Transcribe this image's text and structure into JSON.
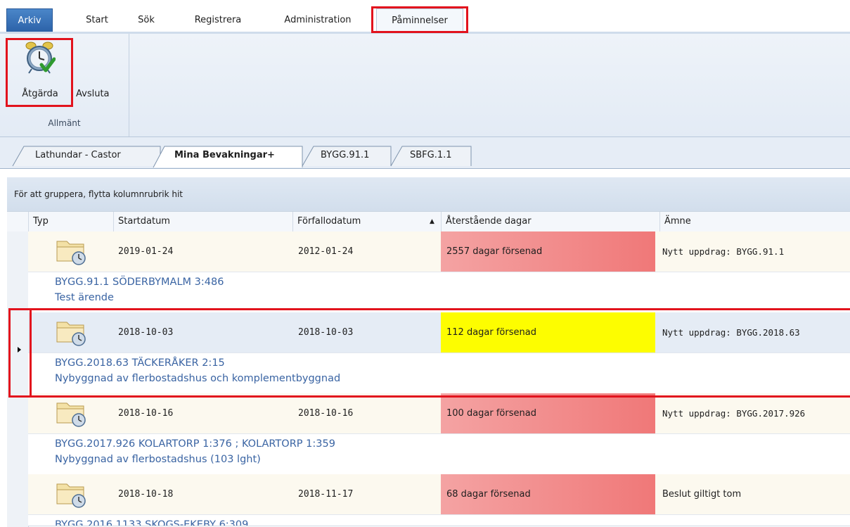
{
  "menu": {
    "tabs": [
      "Arkiv",
      "Start",
      "Sök",
      "Registrera",
      "Administration",
      "Påminnelser"
    ],
    "active": "Påminnelser"
  },
  "ribbon": {
    "buttons": [
      {
        "label": "Åtgärda",
        "icon": "alarm-clock-check-icon"
      },
      {
        "label": "Avsluta"
      }
    ],
    "group_label": "Allmänt"
  },
  "doc_tabs": [
    {
      "label": "Lathundar - Castor"
    },
    {
      "label": "Mina Bevakningar+"
    },
    {
      "label": "BYGG.91.1"
    },
    {
      "label": "SBFG.1.1"
    }
  ],
  "grid": {
    "group_hint": "För att gruppera, flytta kolumnrubrik hit",
    "columns": [
      "Typ",
      "Startdatum",
      "Förfallodatum",
      "Återstående dagar",
      "Ämne"
    ],
    "sorted_column": "Förfallodatum",
    "rows": [
      {
        "start": "2019-01-24",
        "due": "2012-01-24",
        "remaining": "2557 dagar försenad",
        "status": "red",
        "subject": "Nytt uppdrag: BYGG.91.1",
        "line1": "BYGG.91.1  SÖDERBYMALM 3:486",
        "line2": "Test ärende"
      },
      {
        "start": "2018-10-03",
        "due": "2018-10-03",
        "remaining": "112 dagar försenad",
        "status": "yellow",
        "subject": "Nytt uppdrag: BYGG.2018.63",
        "line1": "BYGG.2018.63  TÄCKERÅKER 2:15",
        "line2": "Nybyggnad av flerbostadshus och komplementbyggnad"
      },
      {
        "start": "2018-10-16",
        "due": "2018-10-16",
        "remaining": "100 dagar försenad",
        "status": "red",
        "subject": "Nytt uppdrag: BYGG.2017.926",
        "line1": "BYGG.2017.926  KOLARTORP 1:376 ; KOLARTORP 1:359",
        "line2": "Nybyggnad av flerbostadshus (103 lght)"
      },
      {
        "start": "2018-10-18",
        "due": "2018-11-17",
        "remaining": "68 dagar försenad",
        "status": "red",
        "subject": "Beslut giltigt tom",
        "line1": "BYGG.2016.1133  SKOGS-EKEBY 6:309",
        "line2": ""
      }
    ]
  },
  "colors": {
    "highlight": "#e2131d",
    "overdue": "#f07878",
    "warning": "#fdfd00",
    "link": "#3a64a3"
  }
}
